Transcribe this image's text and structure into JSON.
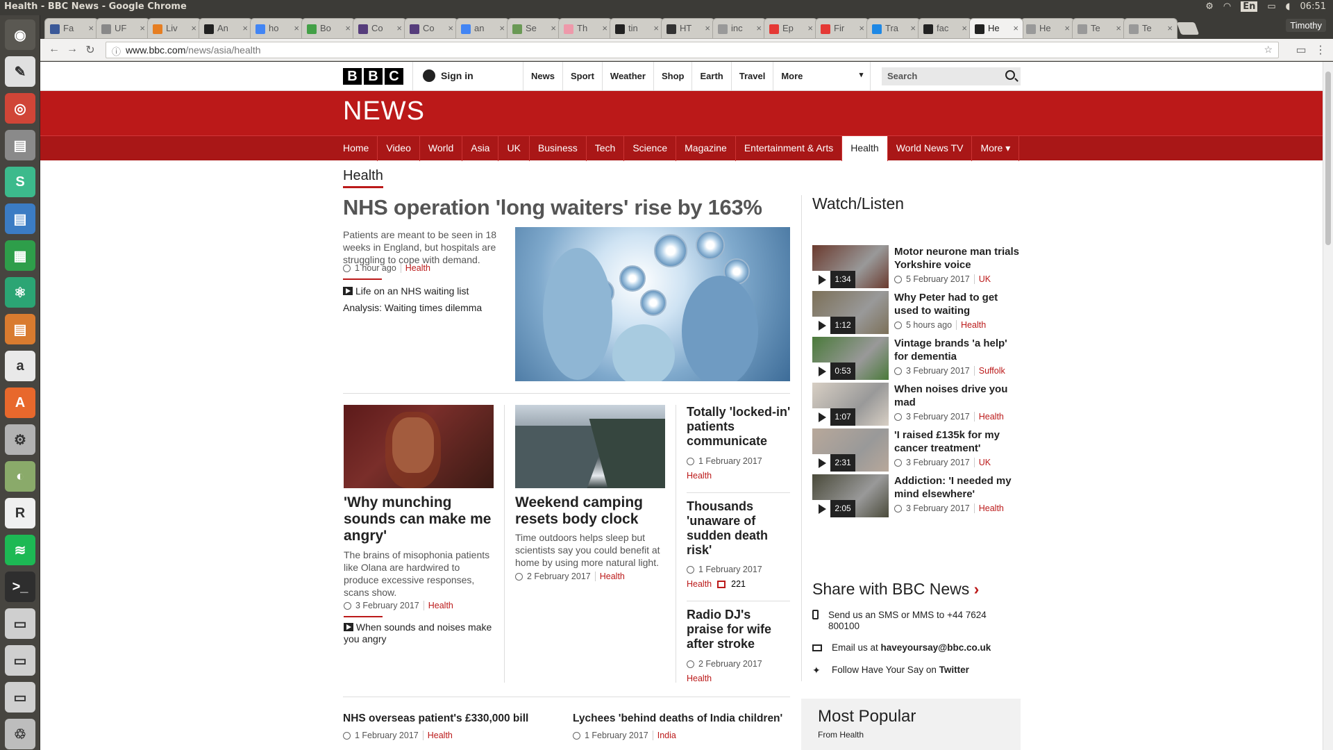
{
  "window": {
    "title": "Health - BBC News - Google Chrome"
  },
  "tray": {
    "settings": "⚙",
    "wifi": "◠",
    "lang": "En",
    "battery": "▭",
    "volume": "◖",
    "time": "06:51"
  },
  "launcher": [
    {
      "name": "dash-icon",
      "bg": "#5a5852",
      "glyph": "◉"
    },
    {
      "name": "pdf-reader-icon",
      "bg": "#e0e0e0",
      "glyph": "✎"
    },
    {
      "name": "chrome-icon",
      "bg": "#d04537",
      "glyph": "◎"
    },
    {
      "name": "file-manager-icon",
      "bg": "#8a8a8a",
      "glyph": "▤"
    },
    {
      "name": "slack-icon",
      "bg": "#3cba8c",
      "glyph": "S"
    },
    {
      "name": "writer-icon",
      "bg": "#3b7cc4",
      "glyph": "▤"
    },
    {
      "name": "calc-icon",
      "bg": "#2e9e4a",
      "glyph": "▦"
    },
    {
      "name": "atom-icon",
      "bg": "#2ba574",
      "glyph": "⚛"
    },
    {
      "name": "impress-icon",
      "bg": "#d97b2f",
      "glyph": "▤"
    },
    {
      "name": "amazon-icon",
      "bg": "#e9e9e9",
      "glyph": "a"
    },
    {
      "name": "software-center-icon",
      "bg": "#e8682c",
      "glyph": "A"
    },
    {
      "name": "settings-tool-icon",
      "bg": "#b2b2b2",
      "glyph": "⚙"
    },
    {
      "name": "disk-usage-icon",
      "bg": "#8aaa6a",
      "glyph": "◐"
    },
    {
      "name": "rstudio-icon",
      "bg": "#f0f0f0",
      "glyph": "R"
    },
    {
      "name": "spotify-icon",
      "bg": "#1db954",
      "glyph": "≋"
    },
    {
      "name": "terminal-icon",
      "bg": "#2e2e2e",
      "glyph": ">_"
    },
    {
      "name": "drive-icon-1",
      "bg": "#cfcfcf",
      "glyph": "▭"
    },
    {
      "name": "drive-icon-2",
      "bg": "#cfcfcf",
      "glyph": "▭"
    },
    {
      "name": "drive-icon-3",
      "bg": "#cfcfcf",
      "glyph": "▭"
    },
    {
      "name": "trash-icon",
      "bg": "#bdbdbd",
      "glyph": "♲"
    }
  ],
  "tabs": [
    {
      "label": "Fa",
      "color": "#3b5998"
    },
    {
      "label": "UF",
      "color": "#888"
    },
    {
      "label": "Liv",
      "color": "#e67e22"
    },
    {
      "label": "An",
      "color": "#222"
    },
    {
      "label": "ho",
      "color": "#4285f4"
    },
    {
      "label": "Bo",
      "color": "#43a047"
    },
    {
      "label": "Co",
      "color": "#563d7c"
    },
    {
      "label": "Co",
      "color": "#563d7c"
    },
    {
      "label": "an",
      "color": "#4285f4"
    },
    {
      "label": "Se",
      "color": "#6a9955"
    },
    {
      "label": "Th",
      "color": "#e9a"
    },
    {
      "label": "tin",
      "color": "#222"
    },
    {
      "label": "HT",
      "color": "#333"
    },
    {
      "label": "inc",
      "color": "#999"
    },
    {
      "label": "Ep",
      "color": "#e53935"
    },
    {
      "label": "Fir",
      "color": "#e53935"
    },
    {
      "label": "Tra",
      "color": "#1e88e5"
    },
    {
      "label": "fac",
      "color": "#222"
    },
    {
      "label": "He",
      "color": "#222",
      "active": true
    },
    {
      "label": "He",
      "color": "#999"
    },
    {
      "label": "Te",
      "color": "#999"
    },
    {
      "label": "Te",
      "color": "#999"
    }
  ],
  "user": "Timothy",
  "address": {
    "host": "www.bbc.com",
    "path": "/news/asia/health"
  },
  "bbc": {
    "logo": [
      "B",
      "B",
      "C"
    ],
    "signin": "Sign in",
    "nav": [
      "News",
      "Sport",
      "Weather",
      "Shop",
      "Earth",
      "Travel",
      "More"
    ],
    "search": "Search",
    "news_logo": "NEWS",
    "secnav": [
      "Home",
      "Video",
      "World",
      "Asia",
      "UK",
      "Business",
      "Tech",
      "Science",
      "Magazine",
      "Entertainment & Arts",
      "Health",
      "World News TV",
      "More ▾"
    ],
    "active_secnav": "Health",
    "section_title": "Health"
  },
  "lead": {
    "title": "NHS operation 'long waiters' rise by 163%",
    "summary": "Patients are meant to be seen in 18 weeks in England, but hospitals are struggling to cope with demand.",
    "time": "1 hour ago",
    "tag": "Health",
    "related1": "Life on an NHS waiting list",
    "related2": "Analysis: Waiting times dilemma"
  },
  "card1": {
    "title": "'Why munching sounds can make me angry'",
    "summary": "The brains of misophonia patients like Olana are hardwired to produce excessive responses, scans show.",
    "time": "3 February 2017",
    "tag": "Health",
    "related": "When sounds and noises make you angry"
  },
  "card2": {
    "title": "Weekend camping resets body clock",
    "summary": "Time outdoors helps sleep but scientists say you could benefit at home by using more natural light.",
    "time": "2 February 2017",
    "tag": "Health"
  },
  "side_stories": [
    {
      "title": "Totally 'locked-in' patients communicate",
      "time": "1 February 2017",
      "tag": "Health"
    },
    {
      "title": "Thousands 'unaware of sudden death risk'",
      "time": "1 February 2017",
      "tag": "Health",
      "comments": "221"
    },
    {
      "title": "Radio DJ's praise for wife after stroke",
      "time": "2 February 2017",
      "tag": "Health"
    }
  ],
  "bottom": [
    {
      "title": "NHS overseas patient's £330,000 bill",
      "time": "1 February 2017",
      "tag": "Health"
    },
    {
      "title": "Lychees 'behind deaths of India children'",
      "time": "1 February 2017",
      "tag": "India"
    }
  ],
  "watch": {
    "heading": "Watch/Listen",
    "items": [
      {
        "title": "Motor neurone man trials Yorkshire voice",
        "duration": "1:34",
        "time": "5 February 2017",
        "tag": "UK",
        "thumb": "#6b3a2e"
      },
      {
        "title": "Why Peter had to get used to waiting",
        "duration": "1:12",
        "time": "5 hours ago",
        "tag": "Health",
        "thumb": "#7c7058"
      },
      {
        "title": "Vintage brands 'a help' for dementia",
        "duration": "0:53",
        "time": "3 February 2017",
        "tag": "Suffolk",
        "thumb": "#4a7a3a"
      },
      {
        "title": "When noises drive you mad",
        "duration": "1:07",
        "time": "3 February 2017",
        "tag": "Health",
        "thumb": "#d8cfc4"
      },
      {
        "title": "'I raised £135k for my cancer treatment'",
        "duration": "2:31",
        "time": "3 February 2017",
        "tag": "UK",
        "thumb": "#b8a89a"
      },
      {
        "title": "Addiction: 'I needed my mind elsewhere'",
        "duration": "2:05",
        "time": "3 February 2017",
        "tag": "Health",
        "thumb": "#4a4a3a"
      }
    ]
  },
  "share": {
    "heading": "Share with BBC News",
    "sms": "Send us an SMS or MMS to +44 7624 800100",
    "email_prefix": "Email us at",
    "email": "haveyoursay@bbc.co.uk",
    "follow_prefix": "Follow Have Your Say on",
    "twitter": "Twitter"
  },
  "popular": {
    "heading": "Most Popular",
    "sub": "From Health"
  }
}
